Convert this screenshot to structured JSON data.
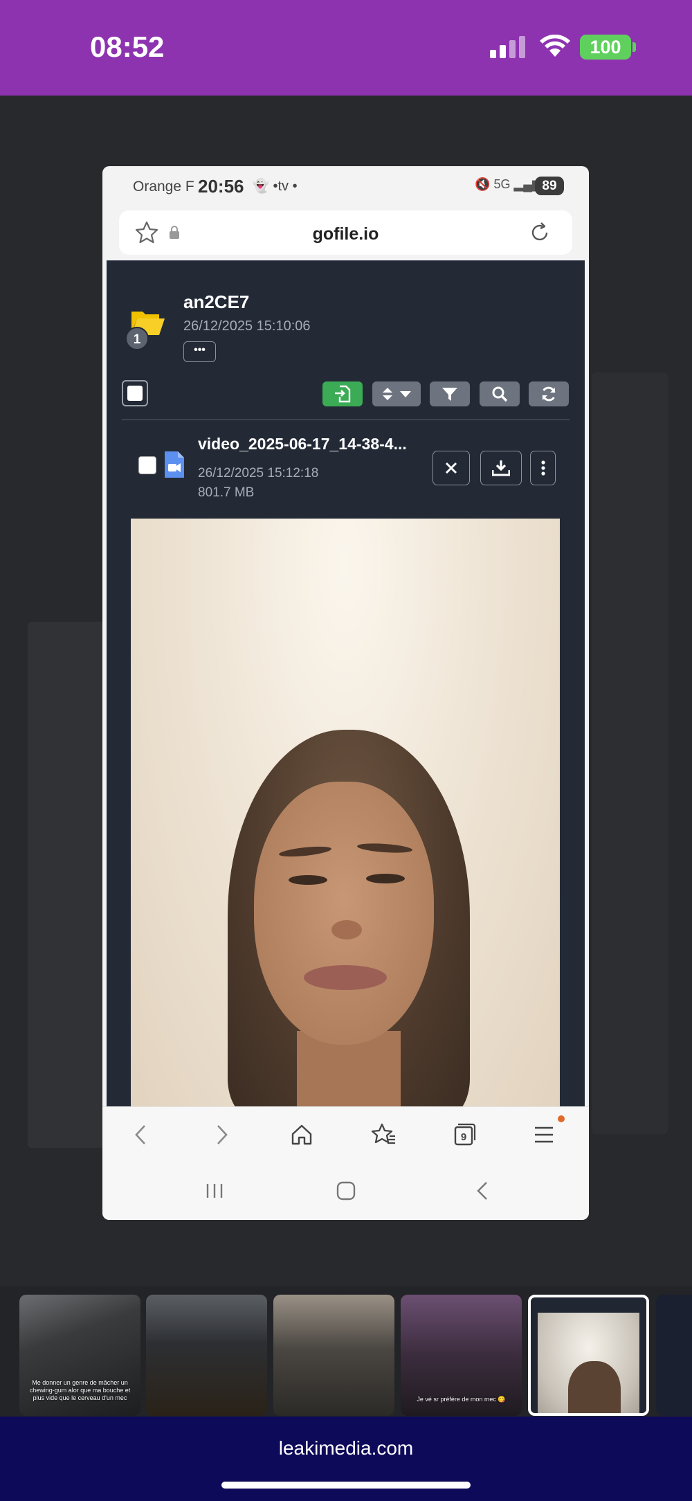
{
  "ios_status": {
    "time": "08:52",
    "battery": "100"
  },
  "android_status": {
    "carrier": "Orange F",
    "time": "20:56",
    "icons": "•tv  •",
    "network": "5G",
    "battery": "89"
  },
  "browser": {
    "url": "gofile.io"
  },
  "folder": {
    "name": "an2CE7",
    "date": "26/12/2025 15:10:06",
    "badge": "1",
    "more_label": "•••"
  },
  "file": {
    "name": "video_2025-06-17_14-38-4...",
    "date": "26/12/2025 15:12:18",
    "size": "801.7 MB"
  },
  "thumbnails": [
    {
      "caption": "Me donner un genre de mâcher un chewing-gum alor que ma bouche et plus vide que le cerveau d'un mec"
    },
    {
      "caption": ""
    },
    {
      "caption": ""
    },
    {
      "caption": "Je vé sr préfére de mon mec 😋"
    },
    {
      "caption": ""
    }
  ],
  "footer": {
    "site": "leakimedia.com"
  },
  "colors": {
    "ios_bar": "#8e33b0",
    "page_bg": "#232a36",
    "accent_green": "#3cab55",
    "footer_bg": "#0e0a5a"
  }
}
